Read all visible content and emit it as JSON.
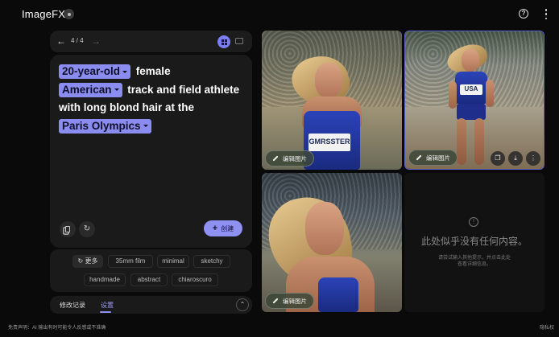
{
  "header": {
    "app_title": "ImageFX"
  },
  "nav": {
    "page_indicator": "4 / 4"
  },
  "prompt": {
    "chips": {
      "age": "20-year-old",
      "nationality": "American",
      "event": "Paris Olympics"
    },
    "text": {
      "t1": "female",
      "t2": "track and field athlete",
      "t3": "with long blond hair at the"
    }
  },
  "actions": {
    "create_label": "创建"
  },
  "styles": {
    "more_label": "更多",
    "chips": [
      "35mm film",
      "minimal",
      "sketchy",
      "handmade",
      "abstract",
      "chiaroscuro"
    ]
  },
  "tabs": {
    "history": "修改记录",
    "settings": "设置"
  },
  "images": {
    "edit_label": "编辑图片",
    "bib_1": "GMRSSTER",
    "bib_2": "USA"
  },
  "empty_state": {
    "title": "此处似乎没有任何内容。",
    "sub1": "请尝试输入其他提示，并点击此处",
    "sub2": "查看详细信息。"
  },
  "footer": {
    "disclaimer": "免责声明：AI 输出有时可能令人反感或不准确",
    "privacy": "隐私权"
  },
  "colors": {
    "accent": "#8f91f2",
    "chip": "#8a8cf0",
    "panel": "#1a1a1a",
    "background": "#0a0a0a"
  }
}
